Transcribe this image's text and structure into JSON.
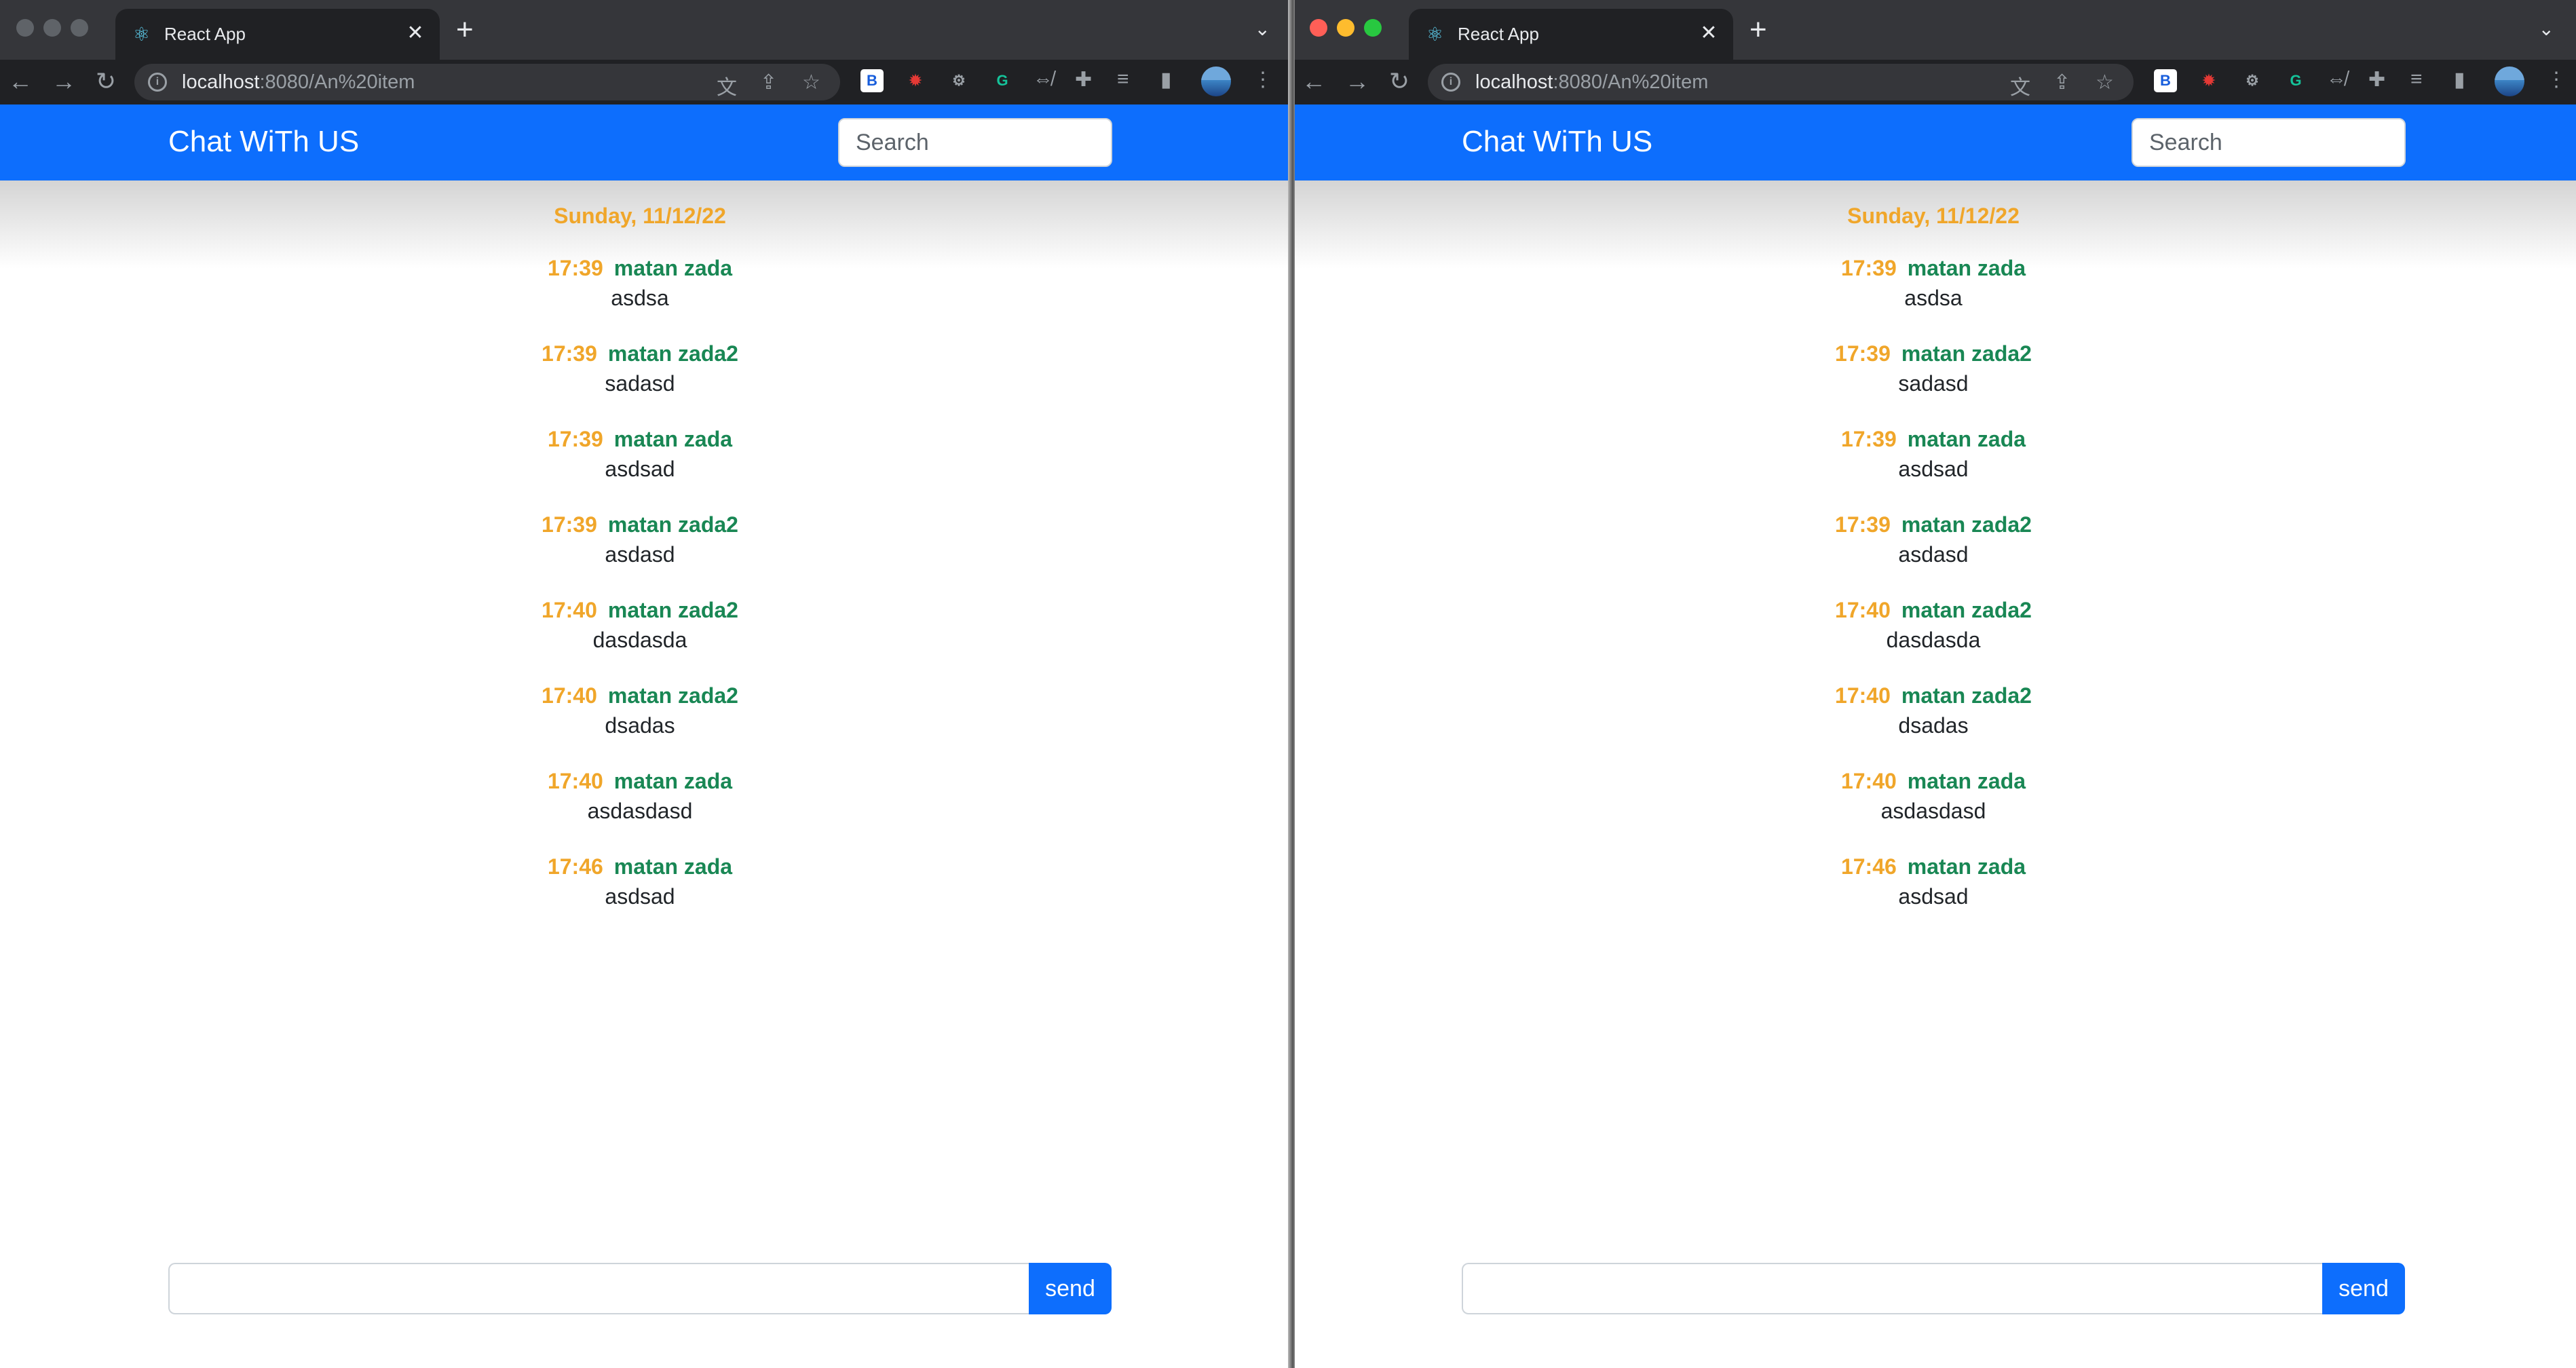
{
  "browser": {
    "tab_title": "React App",
    "tab_close": "✕",
    "new_tab": "+",
    "tab_menu": "⌄",
    "url_host": "localhost",
    "url_rest": ":8080/An%20item",
    "extensions": [
      {
        "icon": "bitwarden-extension-icon",
        "label": "B",
        "color": "#ffffff"
      },
      {
        "icon": "red-extension-icon",
        "label": "✹",
        "color": "#e53935"
      },
      {
        "icon": "gear-extension-icon",
        "label": "⚙",
        "color": "#9aa0a6"
      },
      {
        "icon": "grammarly-extension-icon",
        "label": "G",
        "color": "#15c39a"
      }
    ]
  },
  "navbar": {
    "brand": "Chat WiTh US",
    "search_placeholder": "Search"
  },
  "chat": {
    "date": "Sunday, 11/12/22",
    "messages": [
      {
        "time": "17:39",
        "sender": "matan zada",
        "text": "asdsa"
      },
      {
        "time": "17:39",
        "sender": "matan zada2",
        "text": "sadasd"
      },
      {
        "time": "17:39",
        "sender": "matan zada",
        "text": "asdsad"
      },
      {
        "time": "17:39",
        "sender": "matan zada2",
        "text": "asdasd"
      },
      {
        "time": "17:40",
        "sender": "matan zada2",
        "text": "dasdasda"
      },
      {
        "time": "17:40",
        "sender": "matan zada2",
        "text": "dsadas"
      },
      {
        "time": "17:40",
        "sender": "matan zada",
        "text": "asdasdasd"
      },
      {
        "time": "17:46",
        "sender": "matan zada",
        "text": "asdsad"
      }
    ]
  },
  "composer": {
    "send_label": "send"
  },
  "colors": {
    "navbar": "#0d6efd",
    "time": "#f0a62a",
    "sender": "#198754",
    "traffic_red": "#ff5f57",
    "traffic_yellow": "#febc2e",
    "traffic_green": "#28c840",
    "traffic_inactive": "#5f6368"
  }
}
